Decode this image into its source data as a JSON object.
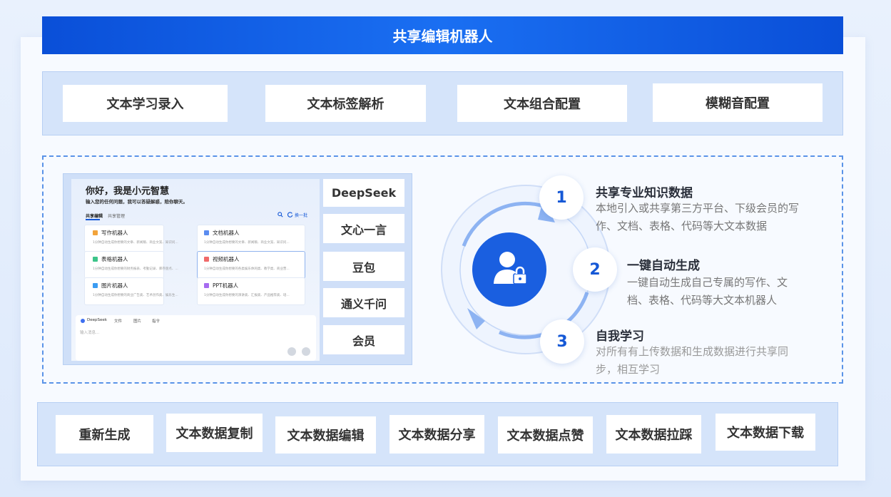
{
  "title": "共享编辑机器人",
  "top_features": [
    "文本学习录入",
    "文本标签解析",
    "文本组合配置",
    "模糊音配置"
  ],
  "bottom_features": [
    "重新生成",
    "文本数据复制",
    "文本数据编辑",
    "文本数据分享",
    "文本数据点赞",
    "文本数据拉踩",
    "文本数据下载"
  ],
  "models": [
    "DeepSeek",
    "文心一言",
    "豆包",
    "通义千问",
    "会员"
  ],
  "app": {
    "greeting": "你好，我是小元智慧",
    "subtitle": "输入您的任何问题，我可以答疑解惑，陪你聊天。",
    "tabs": [
      "共享编辑",
      "共享管理"
    ],
    "switch_label": "换一批",
    "bots": [
      {
        "name": "写作机器人",
        "desc": "1分钟自动生成你想要的文章、新闻稿、商业文案、知识问..."
      },
      {
        "name": "文档机器人",
        "desc": "1分钟自动生成你想要的文章、新闻稿、商业文案、知识问..."
      },
      {
        "name": "表格机器人",
        "desc": "1分钟自动生成你想要的财务报表、考勤记录、库存盘点、..."
      },
      {
        "name": "视频机器人",
        "desc": "1分钟自动生成你想要的各类娱乐休闲类、教学类、商业营..."
      },
      {
        "name": "图片机器人",
        "desc": "1分钟自动生成你想要的商业广告类、艺术创作类、娱乐生..."
      },
      {
        "name": "PPT机器人",
        "desc": "1分钟自动生成你想要的演讲类、汇报类、产品推荐类、培..."
      }
    ],
    "input": {
      "model": "DeepSeek",
      "tools": [
        "文件",
        "图片",
        "指令"
      ],
      "placeholder": "输入消息..."
    }
  },
  "steps": [
    {
      "num": "1",
      "title": "共享专业知识数据",
      "desc_lines": [
        "本地引入或共享第三方平台、下级会员的写",
        "作、文档、表格、代码等大文本数据"
      ]
    },
    {
      "num": "2",
      "title": "一键自动生成",
      "desc_lines": [
        "一键自动生成自己专属的写作、文",
        "档、表格、代码等大文本机器人"
      ]
    },
    {
      "num": "3",
      "title": "自我学习",
      "desc_lines": [
        "对所有有上传数据和生成数据进行共享同",
        "步，相互学习"
      ]
    }
  ],
  "colors": {
    "primary": "#1558d6",
    "panel": "#d5e4fa",
    "dash": "#5a93e8"
  },
  "icons": {
    "center": "user-lock-icon",
    "cycle": "refresh-cycle-icon"
  }
}
